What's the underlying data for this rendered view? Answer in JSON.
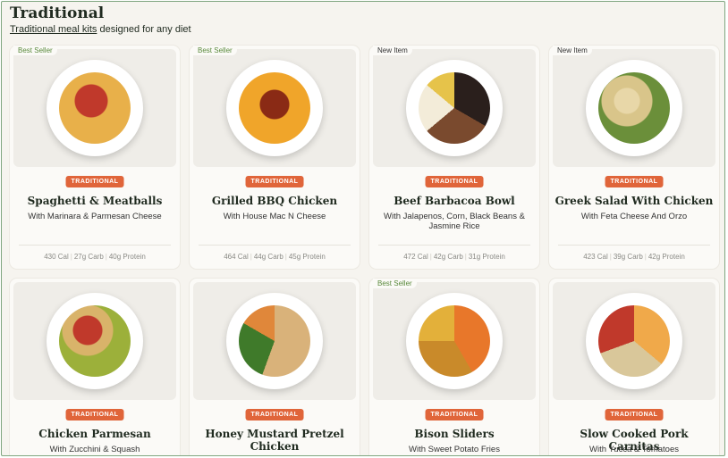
{
  "header": {
    "title": "Traditional",
    "subtitle_link": "Traditional meal kits",
    "subtitle_rest": " designed for any diet"
  },
  "colors": {
    "accent": "#e0653a",
    "best_seller": "#5a8a3c",
    "background": "#f6f4ef"
  },
  "cards": [
    {
      "badge": "Best Seller",
      "category": "TRADITIONAL",
      "name": "Spaghetti & Meatballs",
      "desc": "With Marinara & Parmesan Cheese",
      "cal": "430 Cal",
      "carb": "27g Carb",
      "protein": "40g Protein"
    },
    {
      "badge": "Best Seller",
      "category": "TRADITIONAL",
      "name": "Grilled BBQ Chicken",
      "desc": "With House Mac N Cheese",
      "cal": "464 Cal",
      "carb": "44g Carb",
      "protein": "45g Protein"
    },
    {
      "badge": "New Item",
      "category": "TRADITIONAL",
      "name": "Beef Barbacoa Bowl",
      "desc": "With Jalapenos, Corn, Black Beans & Jasmine Rice",
      "cal": "472 Cal",
      "carb": "42g Carb",
      "protein": "31g Protein"
    },
    {
      "badge": "New Item",
      "category": "TRADITIONAL",
      "name": "Greek Salad With Chicken",
      "desc": "With Feta Cheese And Orzo",
      "cal": "423 Cal",
      "carb": "39g Carb",
      "protein": "42g Protein"
    },
    {
      "badge": "",
      "category": "TRADITIONAL",
      "name": "Chicken Parmesan",
      "desc": "With Zucchini & Squash"
    },
    {
      "badge": "",
      "category": "TRADITIONAL",
      "name": "Honey Mustard Pretzel Chicken",
      "desc": ""
    },
    {
      "badge": "Best Seller",
      "category": "TRADITIONAL",
      "name": "Bison Sliders",
      "desc": "With Sweet Potato Fries"
    },
    {
      "badge": "",
      "category": "TRADITIONAL",
      "name": "Slow Cooked Pork Carnitas",
      "desc": "With Yucca & Tomatoes"
    }
  ]
}
